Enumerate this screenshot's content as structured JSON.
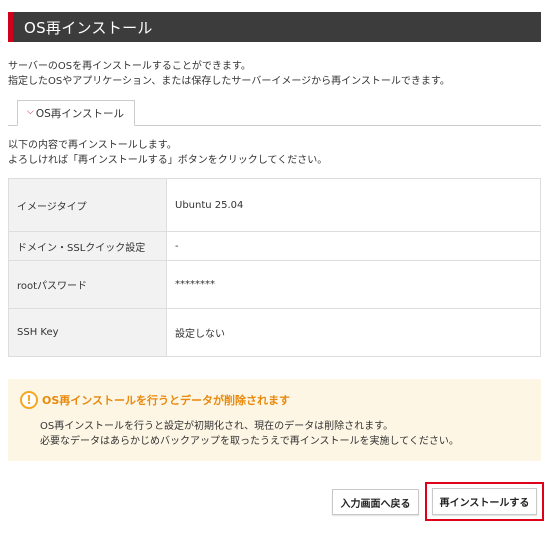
{
  "header": {
    "title": "OS再インストール"
  },
  "intro": {
    "line1": "サーバーのOSを再インストールすることができます。",
    "line2": "指定したOSやアプリケーション、または保存したサーバーイメージから再インストールできます。"
  },
  "tabs": [
    {
      "label": "OS再インストール",
      "icon": "chevron-down-icon",
      "active": true
    }
  ],
  "description": {
    "line1": "以下の内容で再インストールします。",
    "line2": "よろしければ「再インストールする」ボタンをクリックしてください。"
  },
  "info_table": {
    "rows": [
      {
        "label": "イメージタイプ",
        "value": "Ubuntu 25.04"
      },
      {
        "label": "ドメイン・SSLクイック設定",
        "value": "-"
      },
      {
        "label": "rootパスワード",
        "value": "********"
      },
      {
        "label": "SSH Key",
        "value": "設定しない"
      }
    ]
  },
  "warning": {
    "icon": "exclamation-icon",
    "title": "OS再インストールを行うとデータが削除されます",
    "line1": "OS再インストールを行うと設定が初期化され、現在のデータは削除されます。",
    "line2": "必要なデータはあらかじめバックアップを取ったうえで再インストールを実施してください。"
  },
  "buttons": {
    "back_label": "入力画面へ戻る",
    "reinstall_label": "再インストールする"
  },
  "colors": {
    "header_bg": "#3c3c3c",
    "accent_red": "#d0021b",
    "warning_bg": "#fdf6e5",
    "warning_orange": "#e8890c",
    "table_label_bg": "#f2f2f2"
  }
}
